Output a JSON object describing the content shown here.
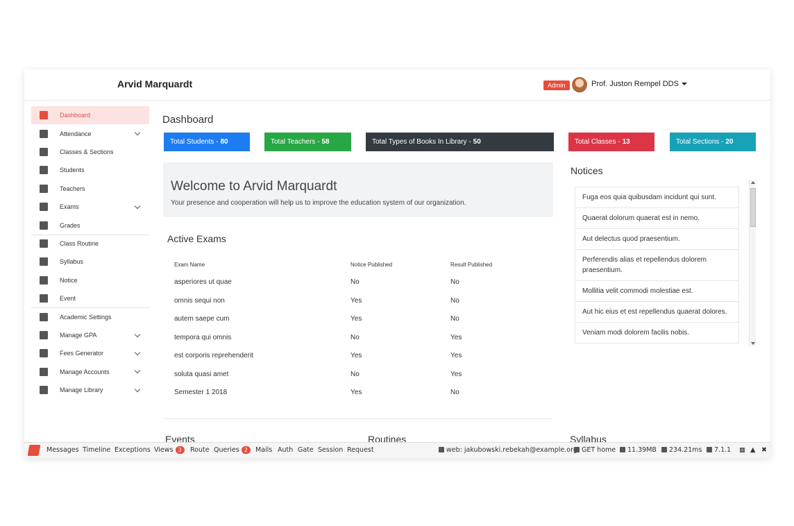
{
  "header": {
    "app_title": "Arvid Marquardt",
    "role_badge": "Admin",
    "user_name": "Prof. Juston Rempel DDS"
  },
  "sidebar": {
    "items": [
      {
        "label": "Dashboard",
        "icon": "dashboard-icon",
        "active": true,
        "expandable": false
      },
      {
        "label": "Attendance",
        "icon": "calendar-icon",
        "active": false,
        "expandable": true
      },
      {
        "label": "Classes & Sections",
        "icon": "book-icon",
        "active": false,
        "expandable": false
      },
      {
        "label": "Students",
        "icon": "id-card-icon",
        "active": false,
        "expandable": false
      },
      {
        "label": "Teachers",
        "icon": "id-card-icon",
        "active": false,
        "expandable": false
      },
      {
        "label": "Exams",
        "icon": "table-icon",
        "active": false,
        "expandable": true
      },
      {
        "label": "Grades",
        "icon": "clipboard-icon",
        "active": false,
        "expandable": false
      },
      {
        "label": "Class Routine",
        "icon": "calendar-icon",
        "active": false,
        "expandable": false
      },
      {
        "label": "Syllabus",
        "icon": "list-icon",
        "active": false,
        "expandable": false
      },
      {
        "label": "Notice",
        "icon": "alert-icon",
        "active": false,
        "expandable": false
      },
      {
        "label": "Event",
        "icon": "calendar-event-icon",
        "active": false,
        "expandable": false
      },
      {
        "label": "Academic Settings",
        "icon": "gear-icon",
        "active": false,
        "expandable": false
      },
      {
        "label": "Manage GPA",
        "icon": "chart-icon",
        "active": false,
        "expandable": true
      },
      {
        "label": "Fees Generator",
        "icon": "dollar-icon",
        "active": false,
        "expandable": true
      },
      {
        "label": "Manage Accounts",
        "icon": "wallet-icon",
        "active": false,
        "expandable": true
      },
      {
        "label": "Manage Library",
        "icon": "library-icon",
        "active": false,
        "expandable": true
      }
    ]
  },
  "main": {
    "page_title": "Dashboard",
    "stats": [
      {
        "label": "Total Students - ",
        "value": "80",
        "color": "#1e7cf2"
      },
      {
        "label": "Total Teachers - ",
        "value": "58",
        "color": "#28a745"
      },
      {
        "label": "Total Types of Books In Library - ",
        "value": "50",
        "color": "#343a40"
      },
      {
        "label": "Total Classes - ",
        "value": "13",
        "color": "#dc3545"
      },
      {
        "label": "Total Sections - ",
        "value": "20",
        "color": "#17a2b8"
      }
    ],
    "welcome": {
      "title": "Welcome to Arvid Marquardt",
      "message": "Your presence and cooperation will help us to improve the education system of our organization."
    },
    "active_exams": {
      "title": "Active Exams",
      "columns": [
        "Exam Name",
        "Notice Published",
        "Result Published"
      ],
      "rows": [
        [
          "asperiores ut quae",
          "No",
          "No"
        ],
        [
          "omnis sequi non",
          "Yes",
          "No"
        ],
        [
          "autem saepe cum",
          "Yes",
          "No"
        ],
        [
          "tempora qui omnis",
          "No",
          "Yes"
        ],
        [
          "est corporis reprehenderit",
          "Yes",
          "Yes"
        ],
        [
          "soluta quasi amet",
          "No",
          "Yes"
        ],
        [
          "Semester 1 2018",
          "Yes",
          "No"
        ]
      ]
    },
    "bottom_sections": {
      "events": "Events",
      "routines": "Routines",
      "syllabus": "Syllabus"
    }
  },
  "notices": {
    "title": "Notices",
    "items": [
      "Fuga eos quia quibusdam incidunt qui sunt.",
      "Quaerat dolorum quaerat est in nemo.",
      "Aut delectus quod praesentium.",
      "Perferendis alias et repellendus dolorem praesentium.",
      "Mollitia velit commodi molestiae est.",
      "Aut hic eius et est repellendus quaerat dolores.",
      "Veniam modi dolorem facilis nobis."
    ]
  },
  "debugbar": {
    "tabs": [
      {
        "label": "Messages"
      },
      {
        "label": "Timeline"
      },
      {
        "label": "Exceptions"
      },
      {
        "label": "Views",
        "badge": "3"
      },
      {
        "label": "Route"
      },
      {
        "label": "Queries",
        "badge": "2"
      },
      {
        "label": "Mails"
      },
      {
        "label": "Auth"
      },
      {
        "label": "Gate"
      },
      {
        "label": "Session"
      },
      {
        "label": "Request"
      }
    ],
    "user": "web: jakubowski.rebekah@example.org",
    "route": "GET home",
    "memory": "11.39MB",
    "time": "234.21ms",
    "version": "7.1.1"
  }
}
